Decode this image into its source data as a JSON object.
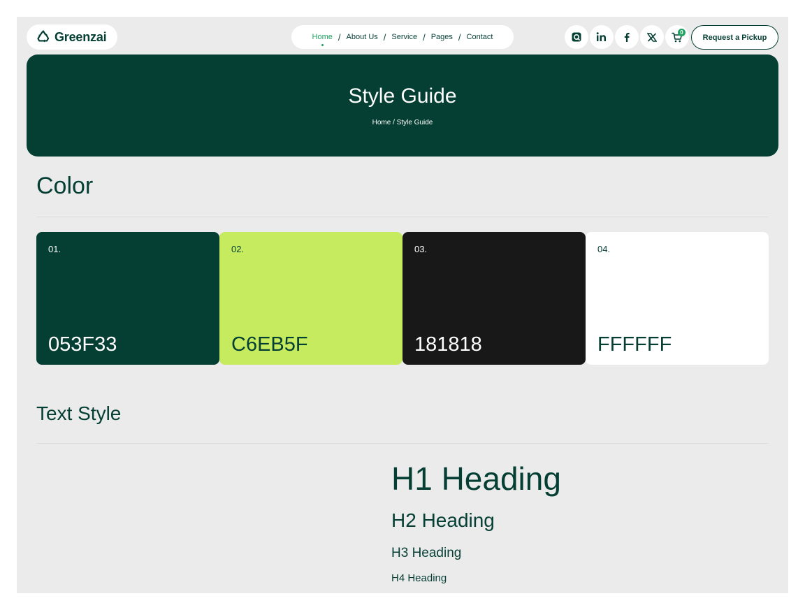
{
  "brand": {
    "name": "Greenzai",
    "logo_icon": "recycle-icon"
  },
  "nav": {
    "items": [
      {
        "label": "Home",
        "active": true
      },
      {
        "label": "About Us"
      },
      {
        "label": "Service"
      },
      {
        "label": "Pages"
      },
      {
        "label": "Contact"
      }
    ],
    "separator": "/"
  },
  "social": [
    "instagram-icon",
    "linkedin-icon",
    "facebook-icon",
    "x-icon"
  ],
  "cart": {
    "icon": "cart-icon",
    "count": "0"
  },
  "cta": {
    "label": "Request a Pickup"
  },
  "hero": {
    "title": "Style Guide",
    "breadcrumb": {
      "home": "Home",
      "sep": "/",
      "current": "Style Guide"
    }
  },
  "color_section": {
    "title": "Color",
    "swatches": [
      {
        "num": "01.",
        "hex": "053F33",
        "bg": "#053f33",
        "fg": "#ffffff"
      },
      {
        "num": "02.",
        "hex": "C6EB5F",
        "bg": "#c6eb5f",
        "fg": "#053f33"
      },
      {
        "num": "03.",
        "hex": "181818",
        "bg": "#181818",
        "fg": "#ffffff"
      },
      {
        "num": "04.",
        "hex": "FFFFFF",
        "bg": "#ffffff",
        "fg": "#053f33"
      }
    ]
  },
  "text_section": {
    "title": "Text Style",
    "headings": [
      "H1 Heading",
      "H2 Heading",
      "H3 Heading",
      "H4 Heading"
    ]
  },
  "colors": {
    "primary": "#053f33",
    "accent": "#c6eb5f",
    "dark": "#181818",
    "active": "#1ea362",
    "background": "#ebebeb"
  }
}
